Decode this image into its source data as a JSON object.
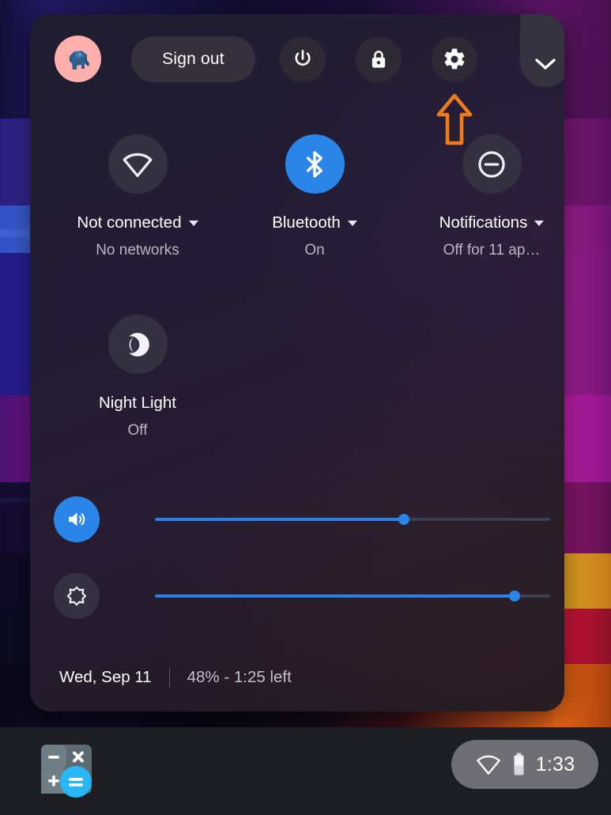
{
  "panel": {
    "header": {
      "avatar": {
        "name": "user-avatar",
        "icon": "elephant-avatar-icon",
        "background_color": "#ffb0ad"
      },
      "sign_out_label": "Sign out",
      "buttons": [
        {
          "name": "power-button",
          "icon": "power-icon"
        },
        {
          "name": "lock-button",
          "icon": "lock-icon"
        },
        {
          "name": "settings-button",
          "icon": "gear-icon"
        }
      ],
      "collapse": {
        "name": "collapse-button",
        "icon": "chevron-down-icon"
      }
    },
    "tiles": [
      {
        "id": "network",
        "icon": "wifi-no-connection-icon",
        "label": "Not connected",
        "sublabel": "No networks",
        "active": false,
        "has_caret": true
      },
      {
        "id": "bluetooth",
        "icon": "bluetooth-icon",
        "label": "Bluetooth",
        "sublabel": "On",
        "active": true,
        "has_caret": true
      },
      {
        "id": "notifications",
        "icon": "do-not-disturb-icon",
        "label": "Notifications",
        "sublabel": "Off for 11 ap…",
        "active": false,
        "has_caret": true
      },
      {
        "id": "night-light",
        "icon": "moon-icon",
        "label": "Night Light",
        "sublabel": "Off",
        "active": false,
        "has_caret": false
      }
    ],
    "sliders": [
      {
        "id": "volume",
        "icon": "volume-up-icon",
        "percent": 63,
        "active": true
      },
      {
        "id": "brightness",
        "icon": "brightness-icon",
        "percent": 91,
        "active": false
      }
    ],
    "footer": {
      "date": "Wed, Sep 11",
      "battery": "48% - 1:25 left"
    }
  },
  "annotation": {
    "name": "settings-highlight-arrow",
    "shape": "up-arrow",
    "color": "#f07a1e"
  },
  "shelf": {
    "apps": [
      {
        "name": "calculator-app-icon",
        "label": "Calculator"
      }
    ],
    "tray": {
      "wifi_icon": "wifi-no-connection-icon",
      "battery_icon": "battery-half-icon",
      "time": "1:33"
    }
  },
  "colors": {
    "accent_blue": "#2a85e8",
    "panel_bg": "#221d33",
    "tile_bg": "#343141",
    "annotation_orange": "#f07a1e",
    "tray_bg": "#6e6e74"
  }
}
